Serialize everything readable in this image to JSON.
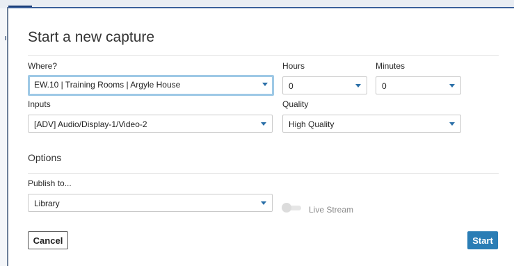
{
  "dialog": {
    "title": "Start a new capture",
    "where_label": "Where?",
    "where_value": "EW.10 | Training Rooms | Argyle House",
    "hours_label": "Hours",
    "hours_value": "0",
    "minutes_label": "Minutes",
    "minutes_value": "0",
    "inputs_label": "Inputs",
    "inputs_value": "[ADV] Audio/Display-1/Video-2",
    "quality_label": "Quality",
    "quality_value": "High Quality",
    "options_title": "Options",
    "publish_label": "Publish to...",
    "publish_value": "Library",
    "live_stream_label": "Live Stream",
    "live_stream_on": false,
    "cancel_label": "Cancel",
    "start_label": "Start"
  },
  "colors": {
    "accent": "#2a7db5",
    "focus_ring": "#9ec9e6",
    "caret": "#2a6fa8"
  },
  "icons": {
    "dropdown": "chevron-down-icon"
  }
}
